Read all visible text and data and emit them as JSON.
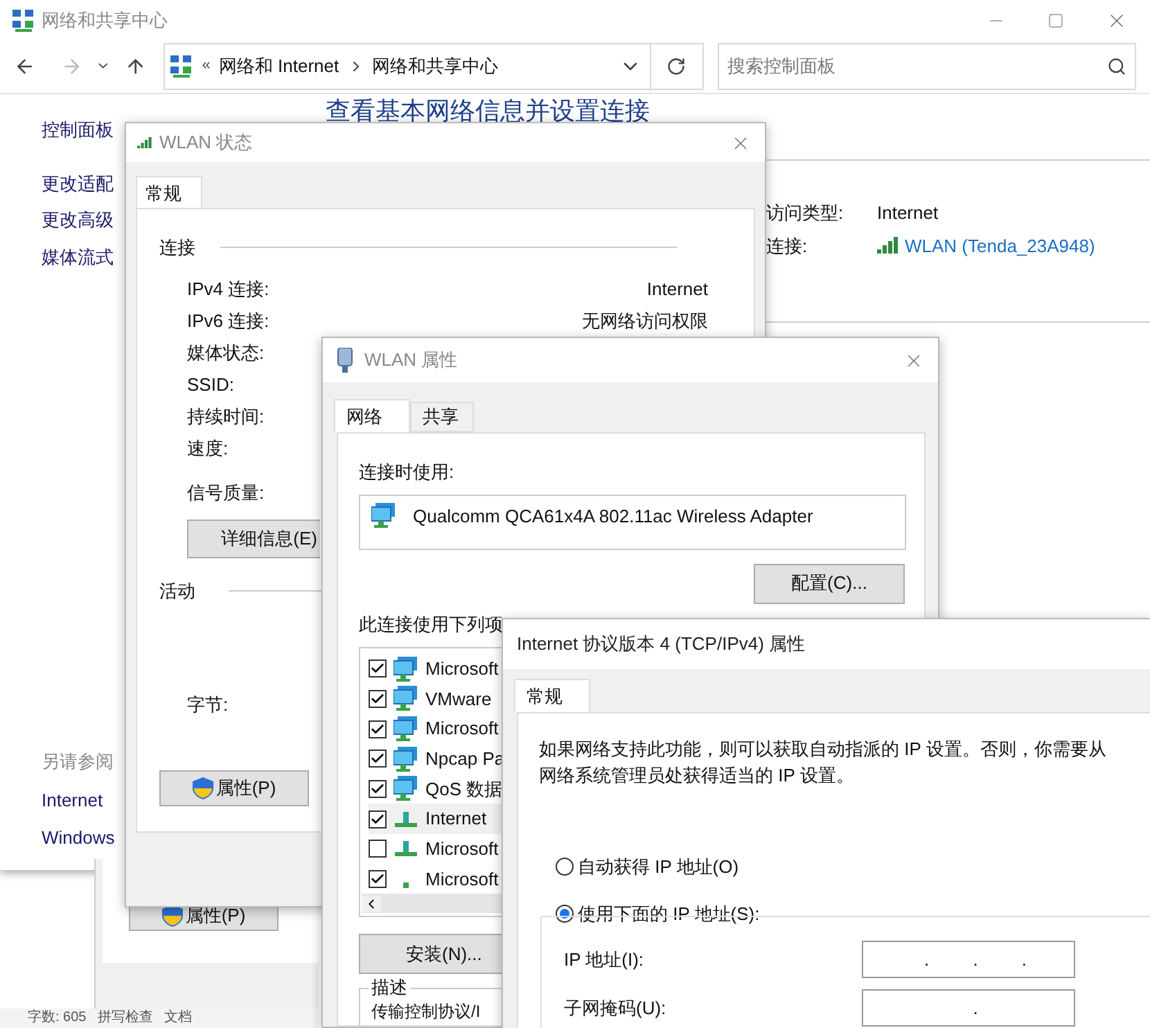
{
  "main_window": {
    "title": "网络和共享中心",
    "address": {
      "overflow": "«",
      "crumbs": [
        "网络和 Internet",
        "网络和共享中心"
      ]
    },
    "search": {
      "placeholder": "搜索控制面板"
    },
    "sidebar": {
      "items": [
        "控制面板",
        "更改适配",
        "更改高级",
        "媒体流式"
      ],
      "see_also_title": "另请参阅",
      "see_also": [
        "Internet",
        "Windows"
      ]
    },
    "heading": "查看基本网络信息并设置连接",
    "network_info": [
      {
        "label": "访问类型:",
        "value": "Internet",
        "kind": "text"
      },
      {
        "label": "连接:",
        "value": "WLAN (Tenda_23A948)",
        "kind": "link"
      }
    ]
  },
  "status_window": {
    "title": "WLAN 状态",
    "tabs": [
      {
        "label": "常规",
        "selected": true
      }
    ],
    "connection_title": "连接",
    "rows": [
      {
        "label": "IPv4 连接:",
        "value": "Internet"
      },
      {
        "label": "IPv6 连接:",
        "value": "无网络访问权限"
      },
      {
        "label": "媒体状态:"
      },
      {
        "label": "SSID:"
      },
      {
        "label": "持续时间:"
      },
      {
        "label": "速度:"
      }
    ],
    "signal_label": "信号质量:",
    "details_button": "详细信息(E)",
    "activity_title": "活动",
    "bytes_label": "字节:",
    "properties_button": "属性(P)"
  },
  "properties_window": {
    "title": "WLAN 属性",
    "tabs": [
      {
        "label": "网络",
        "selected": true
      },
      {
        "label": "共享",
        "selected": false
      }
    ],
    "connect_using_label": "连接时使用:",
    "adapter": "Qualcomm QCA61x4A 802.11ac Wireless Adapter",
    "configure_button": "配置(C)...",
    "items_label": "此连接使用下列项",
    "items": [
      {
        "label": "Microsoft",
        "checked": true,
        "selected": false,
        "kind": "client"
      },
      {
        "label": "VMware",
        "checked": true,
        "selected": false,
        "kind": "client"
      },
      {
        "label": "Microsoft",
        "checked": true,
        "selected": false,
        "kind": "client"
      },
      {
        "label": "Npcap Pa",
        "checked": true,
        "selected": false,
        "kind": "client"
      },
      {
        "label": "QoS 数据",
        "checked": true,
        "selected": false,
        "kind": "client"
      },
      {
        "label": "Internet",
        "checked": true,
        "selected": true,
        "kind": "protocol"
      },
      {
        "label": "Microsoft",
        "checked": false,
        "selected": false,
        "kind": "protocol"
      },
      {
        "label": "Microsoft",
        "checked": true,
        "selected": false,
        "kind": "dot"
      }
    ],
    "install_button": "安装(N)...",
    "description_title": "描述",
    "description": "传输控制协议/I"
  },
  "ipv4_window": {
    "title": "Internet 协议版本 4 (TCP/IPv4) 属性",
    "tabs": [
      {
        "label": "常规",
        "selected": true
      }
    ],
    "intro": "如果网络支持此功能，则可以获取自动指派的 IP 设置。否则，你需要从网络系统管理员处获得适当的 IP 设置。",
    "options": [
      {
        "label": "自动获得 IP 地址(O)",
        "selected": false
      },
      {
        "label": "使用下面的 IP 地址(S):",
        "selected": true
      }
    ],
    "fields": [
      {
        "label": "IP 地址(I):",
        "value": ". . ."
      },
      {
        "label": "子网掩码(U):",
        "value": "."
      }
    ]
  },
  "back_window": {
    "button": "属性(P)"
  },
  "status_bar": [
    "字数: 605",
    "拼写检查",
    "文档"
  ]
}
